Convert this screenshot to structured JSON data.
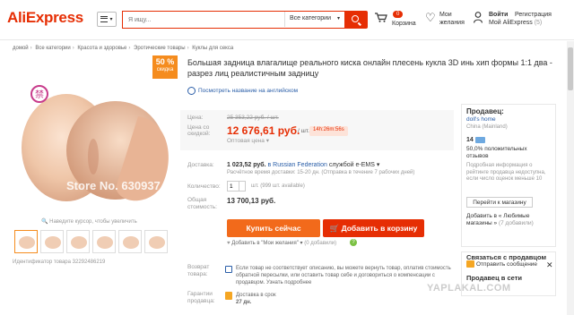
{
  "header": {
    "logo": "AliExpress",
    "search_placeholder": "Я ищу...",
    "search_category": "Все категории",
    "cart_badge": "0",
    "cart_label": "Корзина",
    "wishlist_line1": "Мои",
    "wishlist_line2": "желания",
    "login": "Войти",
    "register": "Регистрация",
    "my_aliexpress": "Мой AliExpress",
    "my_count": "(5)"
  },
  "breadcrumb": [
    "домой",
    "Все категории",
    "Красота и здоровье",
    "Эротические товары",
    "Куклы для секса"
  ],
  "gallery": {
    "discount_pct": "50 %",
    "discount_sub": "скидка",
    "watermark_1": "Store No. 630937",
    "watermark_2": "Store No: 630937",
    "zoom_hint": "Наведите курсор, чтобы увеличить",
    "thumb_count": 6,
    "item_id": "Идентификатор товара 32292486219"
  },
  "product": {
    "title": "Большая задница влагалище реального киска онлайн плесень кукла 3D инь хип формы 1:1 два - разрез лиц реалистичным задницу",
    "translate_link": "Посмотреть название на английском",
    "price_label": "Цена:",
    "old_price": "25 353,22 руб. / шт.",
    "discount_label": "Цена со скидкой:",
    "new_price": "12 676,61 руб.",
    "per_unit": "/ шт.",
    "timer": "14h:26m:56s",
    "wholesale": "Оптовая цена",
    "shipping_label": "Доставка:",
    "shipping_price": "1 023,52 руб.",
    "shipping_to": "в Russian Federation",
    "shipping_service": "службой e-EMS",
    "shipping_sub": "Расчётное время доставки: 15-20 дн. (Отправка в течение 7 рабочих дней)",
    "qty_label": "Количество:",
    "qty_value": "1",
    "qty_available": "шт. (999 шт. available)",
    "total_label_1": "Общая",
    "total_label_2": "стоимость:",
    "total_value": "13 700,13 руб.",
    "buy_now": "Купить сейчас",
    "add_to_cart": "Добавить в корзину",
    "wishlist_add": "Добавить в \"Мои желания\"",
    "wishlist_count": "(0 добавили)",
    "return_label_1": "Возврат",
    "return_label_2": "товара:",
    "return_text": "Если товар не соответствует описанию, вы можете вернуть товар, оплатив стоимость обратной пересылки, или оставить товар себе и договориться о компенсации с продавцом. Узнать подробнее",
    "guarantee_label_1": "Гарантии",
    "guarantee_label_2": "продавца:",
    "guarantee_text_1": "Доставка в срок",
    "guarantee_text_2": "27 дн."
  },
  "seller": {
    "title": "Продавец:",
    "name": "doll's home",
    "location": "China (Mainland)",
    "rank": "14",
    "positive": "50,0% положительных отзывов",
    "info": "Подробная информация о рейтинге продавца недоступна, если число оценок меньше 10",
    "shop_button": "Перейти к магазину",
    "fav_text": "Добавить в « Любимые магазины »",
    "fav_count": "(7 добавили)"
  },
  "contact": {
    "title": "Связаться с продавцом",
    "message": "Отправить сообщение",
    "social": "Продавец в сети"
  },
  "watermark": "YAPLAKAL.COM",
  "colors": {
    "brand": "#e62e04",
    "accent": "#f26a1b",
    "link": "#2a5ea8"
  }
}
